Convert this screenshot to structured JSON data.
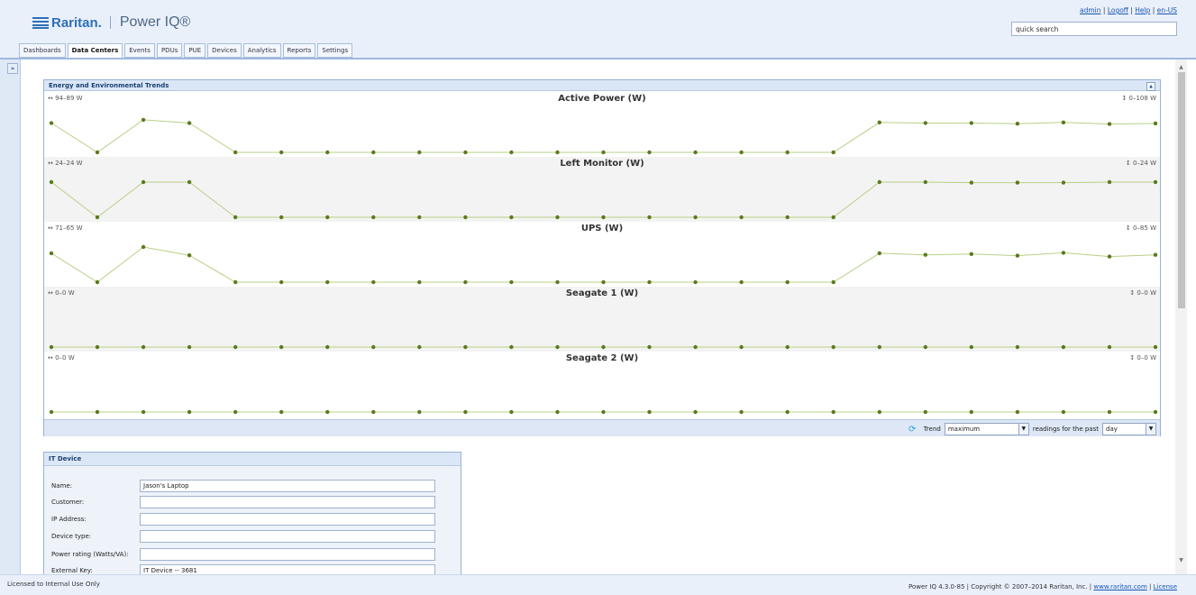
{
  "app": {
    "brand": "Raritan.",
    "product": "Power IQ®"
  },
  "user_links": {
    "user": "admin",
    "logoff": "Logoff",
    "help": "Help",
    "locale": "en-US"
  },
  "search": {
    "value": "quick search"
  },
  "tabs": [
    {
      "label": "Dashboards"
    },
    {
      "label": "Data Centers"
    },
    {
      "label": "Events"
    },
    {
      "label": "PDUs"
    },
    {
      "label": "PUE"
    },
    {
      "label": "Devices"
    },
    {
      "label": "Analytics"
    },
    {
      "label": "Reports"
    },
    {
      "label": "Settings"
    }
  ],
  "active_tab": "Data Centers",
  "sidebar_toggle": "»",
  "trends_panel": {
    "title": "Energy and Environmental Trends",
    "collapse_glyph": "▲",
    "footer": {
      "trend_label": "Trend",
      "trend_value": "maximum",
      "readings_label": "readings for the past",
      "period_value": "day"
    }
  },
  "chart_data": [
    {
      "type": "line",
      "title": "Active Power (W)",
      "range_left": "94–89 W",
      "range_right": "0–108 W",
      "ylim": [
        0,
        108
      ],
      "values": [
        90,
        0,
        100,
        90,
        0,
        0,
        0,
        0,
        0,
        0,
        0,
        0,
        0,
        0,
        0,
        0,
        0,
        0,
        92,
        90,
        90,
        88,
        92,
        87,
        89
      ]
    },
    {
      "type": "line",
      "title": "Left Monitor (W)",
      "range_left": "24–24 W",
      "range_right": "0–24 W",
      "ylim": [
        0,
        24
      ],
      "values": [
        24,
        0,
        24,
        24,
        0,
        0,
        0,
        0,
        0,
        0,
        0,
        0,
        0,
        0,
        0,
        0,
        0,
        0,
        24,
        24,
        23.6,
        23.6,
        23.6,
        24,
        24
      ]
    },
    {
      "type": "line",
      "title": "UPS (W)",
      "range_left": "71–65 W",
      "range_right": "0–85 W",
      "ylim": [
        0,
        85
      ],
      "values": [
        70,
        0,
        85,
        65,
        0,
        0,
        0,
        0,
        0,
        0,
        0,
        0,
        0,
        0,
        0,
        0,
        0,
        0,
        70,
        66,
        68,
        64,
        71,
        62,
        66
      ]
    },
    {
      "type": "line",
      "title": "Seagate 1 (W)",
      "range_left": "0–0 W",
      "range_right": "0–0 W",
      "ylim": [
        0,
        1
      ],
      "values": [
        0,
        0,
        0,
        0,
        0,
        0,
        0,
        0,
        0,
        0,
        0,
        0,
        0,
        0,
        0,
        0,
        0,
        0,
        0,
        0,
        0,
        0,
        0,
        0,
        0
      ]
    },
    {
      "type": "line",
      "title": "Seagate 2 (W)",
      "range_left": "0–0 W",
      "range_right": "0–0 W",
      "ylim": [
        0,
        1
      ],
      "values": [
        0,
        0,
        0,
        0,
        0,
        0,
        0,
        0,
        0,
        0,
        0,
        0,
        0,
        0,
        0,
        0,
        0,
        0,
        0,
        0,
        0,
        0,
        0,
        0,
        0
      ]
    }
  ],
  "chart_style": {
    "line_color": "#b9cf86",
    "point_color": "#5a7a1c",
    "alt_band_color": "#f3f3f3"
  },
  "it_device": {
    "title": "IT Device",
    "fields": [
      {
        "label": "Name:",
        "value": "Jason's Laptop"
      },
      {
        "label": "Customer:",
        "value": ""
      },
      {
        "label": "IP Address:",
        "value": ""
      },
      {
        "label": "Device type:",
        "value": ""
      },
      {
        "label": "Power rating (Watts/VA):",
        "value": ""
      },
      {
        "label": "External Key:",
        "value": "IT Device -- 3681"
      }
    ]
  },
  "status": {
    "left": "Licensed to Internal Use Only",
    "right_text": "Power IQ 4.3.0-85 | Copyright © 2007–2014 Raritan, Inc. |",
    "website": "www.raritan.com",
    "license": "License"
  }
}
